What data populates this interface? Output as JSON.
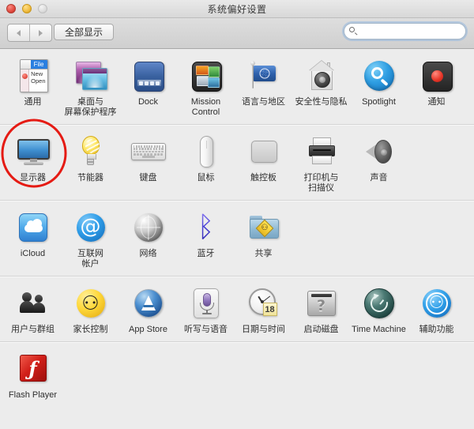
{
  "window": {
    "title": "系统偏好设置",
    "traffic_lights": [
      "close",
      "minimize",
      "zoom"
    ]
  },
  "toolbar": {
    "back_label": "◀",
    "forward_label": "▶",
    "show_all_label": "全部显示",
    "search_placeholder": "",
    "search_value": ""
  },
  "sections": [
    {
      "name": "personal",
      "panes": [
        {
          "label": "通用",
          "icon": "general-icon"
        },
        {
          "label": "桌面与\n屏幕保护程序",
          "icon": "desktop-screensaver-icon"
        },
        {
          "label": "Dock",
          "icon": "dock-icon"
        },
        {
          "label": "Mission\nControl",
          "icon": "mission-control-icon"
        },
        {
          "label": "语言与地区",
          "icon": "language-region-icon"
        },
        {
          "label": "安全性与隐私",
          "icon": "security-privacy-icon"
        },
        {
          "label": "Spotlight",
          "icon": "spotlight-icon"
        },
        {
          "label": "通知",
          "icon": "notifications-icon"
        }
      ]
    },
    {
      "name": "hardware",
      "panes": [
        {
          "label": "显示器",
          "icon": "displays-icon"
        },
        {
          "label": "节能器",
          "icon": "energy-saver-icon"
        },
        {
          "label": "键盘",
          "icon": "keyboard-icon"
        },
        {
          "label": "鼠标",
          "icon": "mouse-icon"
        },
        {
          "label": "触控板",
          "icon": "trackpad-icon"
        },
        {
          "label": "打印机与\n扫描仪",
          "icon": "printers-scanners-icon"
        },
        {
          "label": "声音",
          "icon": "sound-icon"
        }
      ]
    },
    {
      "name": "internet-wireless",
      "panes": [
        {
          "label": "iCloud",
          "icon": "icloud-icon"
        },
        {
          "label": "互联网\n帐户",
          "icon": "internet-accounts-icon"
        },
        {
          "label": "网络",
          "icon": "network-icon"
        },
        {
          "label": "蓝牙",
          "icon": "bluetooth-icon"
        },
        {
          "label": "共享",
          "icon": "sharing-icon"
        }
      ]
    },
    {
      "name": "system",
      "panes": [
        {
          "label": "用户与群组",
          "icon": "users-groups-icon"
        },
        {
          "label": "家长控制",
          "icon": "parental-controls-icon"
        },
        {
          "label": "App Store",
          "icon": "app-store-icon"
        },
        {
          "label": "听写与语音",
          "icon": "dictation-speech-icon"
        },
        {
          "label": "日期与时间",
          "icon": "date-time-icon"
        },
        {
          "label": "启动磁盘",
          "icon": "startup-disk-icon"
        },
        {
          "label": "Time Machine",
          "icon": "time-machine-icon"
        },
        {
          "label": "辅助功能",
          "icon": "accessibility-icon"
        }
      ]
    },
    {
      "name": "third-party",
      "panes": [
        {
          "label": "Flash Player",
          "icon": "flash-player-icon"
        }
      ]
    }
  ],
  "icon_glyphs": {
    "at_symbol": "@",
    "bluetooth": "ᛒ",
    "question_mark": "?",
    "pedestrian": "⚇",
    "parental_figure": "⚇",
    "accessibility_figure": "⚇",
    "flash_f": "ƒ",
    "calendar_day": "18",
    "general_file_menu": "File",
    "general_menu_items": "New\nOpen"
  },
  "annotation": {
    "type": "ellipse",
    "color": "#e51b14",
    "target_label": "显示器",
    "stroke_width": 3
  }
}
